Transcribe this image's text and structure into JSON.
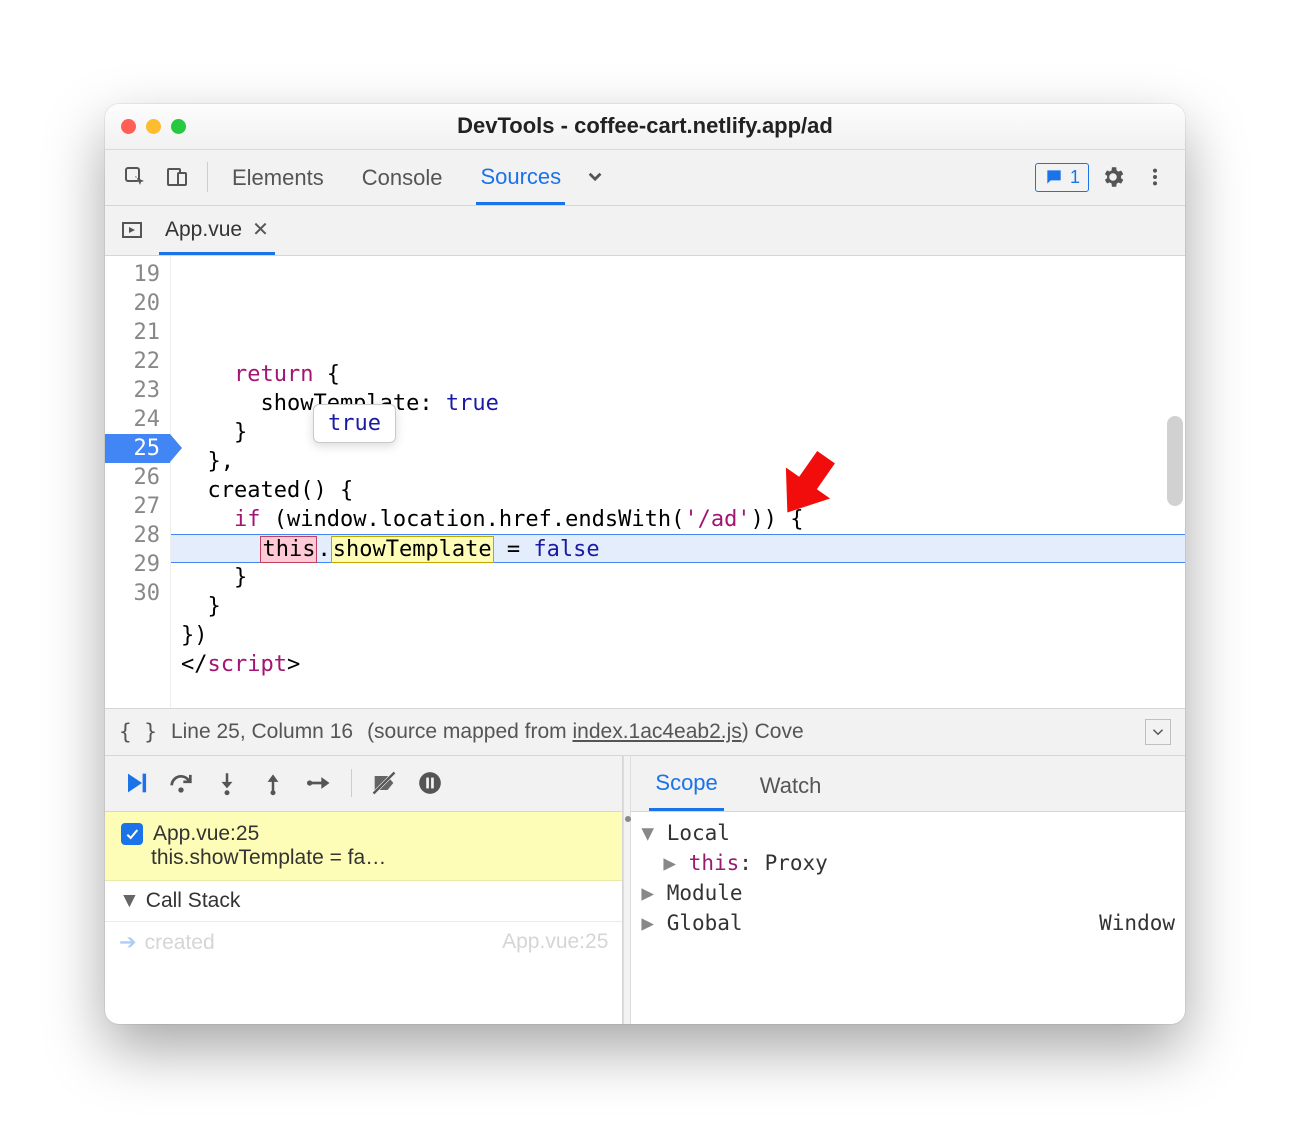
{
  "window": {
    "title": "DevTools - coffee-cart.netlify.app/ad"
  },
  "toolbar": {
    "tabs": [
      "Elements",
      "Console",
      "Sources"
    ],
    "active_tab_index": 2,
    "issues_count": "1"
  },
  "file_tab": {
    "name": "App.vue"
  },
  "editor": {
    "first_line": 19,
    "breakpoint_line": 25,
    "lines": [
      {
        "n": 19,
        "html": "    <span class='kw'>return</span> {"
      },
      {
        "n": 20,
        "html": "      showTemplate: <span class='lit'>true</span>"
      },
      {
        "n": 21,
        "html": "    }"
      },
      {
        "n": 22,
        "html": "  },"
      },
      {
        "n": 23,
        "html": "  created() {"
      },
      {
        "n": 24,
        "html": "    <span class='kw'>if</span> (window.location.href.endsWith(<span class='str'>'/ad'</span>)) {"
      },
      {
        "n": 25,
        "html": "      <span class='hl-this'>this</span>.<span class='hl-prop'>showTemplate</span> = <span class='lit'>false</span>",
        "exec": true
      },
      {
        "n": 26,
        "html": "    }"
      },
      {
        "n": 27,
        "html": "  }"
      },
      {
        "n": 28,
        "html": "})"
      },
      {
        "n": 29,
        "html": "&lt;/<span class='tagc'>script</span>&gt;"
      },
      {
        "n": 30,
        "html": ""
      }
    ],
    "tooltip_value": "true"
  },
  "status": {
    "position": "Line 25, Column 16",
    "mapped_prefix": "(source mapped from ",
    "mapped_file": "index.1ac4eab2.js",
    "mapped_suffix": ")",
    "trailing": " Cove"
  },
  "debugger": {
    "breakpoint": {
      "label": "App.vue:25",
      "src": "this.showTemplate = fa…"
    },
    "callstack_label": "Call Stack",
    "frame": {
      "name": "created",
      "loc": "App.vue:25"
    },
    "scope_tabs": [
      "Scope",
      "Watch"
    ],
    "active_scope_tab": 0,
    "scope": {
      "local_label": "Local",
      "this_key": "this",
      "this_val": "Proxy",
      "module_label": "Module",
      "global_label": "Global",
      "global_val": "Window"
    }
  }
}
